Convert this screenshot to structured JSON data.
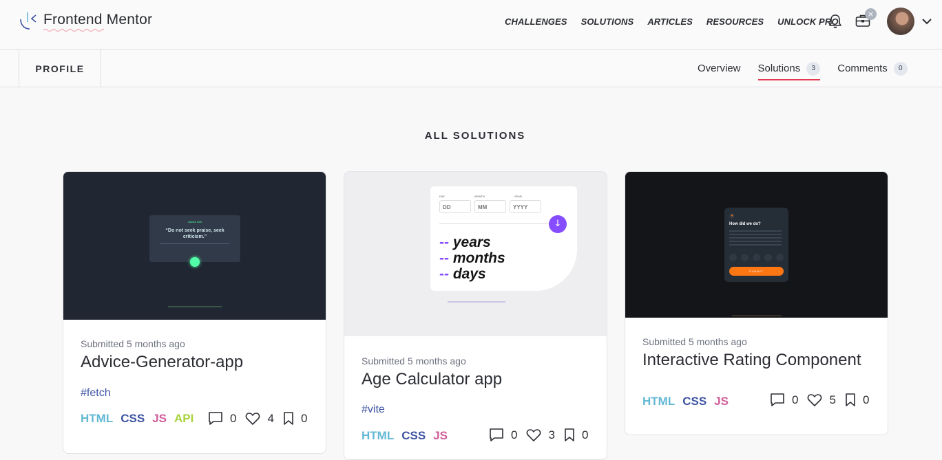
{
  "header": {
    "brand": "Frontend Mentor",
    "nav": [
      "CHALLENGES",
      "SOLUTIONS",
      "ARTICLES",
      "RESOURCES",
      "UNLOCK PRO"
    ]
  },
  "subnav": {
    "profile_label": "PROFILE",
    "tabs": [
      {
        "label": "Overview",
        "count": ""
      },
      {
        "label": "Solutions",
        "count": "3"
      },
      {
        "label": "Comments",
        "count": "0"
      }
    ]
  },
  "section_title": "ALL SOLUTIONS",
  "cards": [
    {
      "submitted": "Submitted 5 months ago",
      "title": "Advice-Generator-app",
      "tag": "#fetch",
      "langs": [
        "HTML",
        "CSS",
        "JS",
        "API"
      ],
      "comments": "0",
      "likes": "4",
      "bookmarks": "0",
      "preview": {
        "label": "Advice #25",
        "quote": "“Do not seek praise, seek criticism.”"
      }
    },
    {
      "submitted": "Submitted 5 months ago",
      "title": "Age Calculator app",
      "tag": "#vite",
      "langs": [
        "HTML",
        "CSS",
        "JS"
      ],
      "comments": "0",
      "likes": "3",
      "bookmarks": "0",
      "preview": {
        "day": "DAY",
        "month": "MONTH",
        "year": "YEAR",
        "dd": "DD",
        "mm": "MM",
        "yyyy": "YYYY",
        "years": "years",
        "months": "months",
        "days": "days",
        "dash": "--"
      }
    },
    {
      "submitted": "Submitted 5 months ago",
      "title": "Interactive Rating Component",
      "tag": "",
      "langs": [
        "HTML",
        "CSS",
        "JS"
      ],
      "comments": "0",
      "likes": "5",
      "bookmarks": "0",
      "preview": {
        "question": "How did we do?",
        "submit": "SUBMIT"
      }
    }
  ],
  "colors": {
    "accent": "#e23b52",
    "html": "#63b8d4",
    "css": "#3e54a3",
    "js": "#d05d9a",
    "api": "#a9d33c"
  }
}
